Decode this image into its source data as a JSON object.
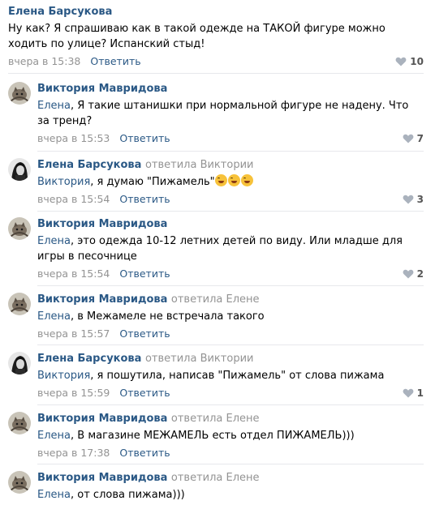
{
  "top": {
    "author": "Елена Барсукова",
    "text": "Ну как? Я спрашиваю как в такой одежде на ТАКОЙ фигуре можно ходить по улице? Испанский стыд!",
    "time": "вчера в 15:38",
    "reply_label": "Ответить",
    "likes": "10"
  },
  "replies": [
    {
      "author": "Виктория Мавридова",
      "replied_to": "",
      "mention": "Елена",
      "text": ", Я такие штанишки при нормальной фигуре не надену. Что за тренд?",
      "time": "вчера в 15:53",
      "reply_label": "Ответить",
      "likes": "7",
      "avatar": "cat-avatar"
    },
    {
      "author": "Елена Барсукова",
      "replied_to": "ответила Виктории",
      "mention": "Виктория",
      "text": ", я думаю \"Пижамель\"",
      "time": "вчера в 15:54",
      "reply_label": "Ответить",
      "likes": "3",
      "avatar": "bw-avatar"
    },
    {
      "author": "Виктория Мавридова",
      "replied_to": "",
      "mention": "Елена",
      "text": ", это одежда 10-12 летних детей по виду. Или младше для игры в песочнице",
      "time": "вчера в 15:54",
      "reply_label": "Ответить",
      "likes": "2",
      "avatar": "cat-avatar"
    },
    {
      "author": "Виктория Мавридова",
      "replied_to": "ответила Елене",
      "mention": "Елена",
      "text": ", в Межамеле не встречала такого",
      "time": "вчера в 15:57",
      "reply_label": "Ответить",
      "likes": "",
      "avatar": "cat-avatar"
    },
    {
      "author": "Елена Барсукова",
      "replied_to": "ответила Виктории",
      "mention": "Виктория",
      "text": ", я пошутила, написав \"Пижамель\" от слова пижама",
      "time": "вчера в 15:59",
      "reply_label": "Ответить",
      "likes": "1",
      "avatar": "bw-avatar"
    },
    {
      "author": "Виктория Мавридова",
      "replied_to": "ответила Елене",
      "mention": "Елена",
      "text": ", В магазине МЕЖАМЕЛЬ есть отдел ПИЖАМЕЛЬ)))",
      "time": "вчера в 17:38",
      "reply_label": "Ответить",
      "likes": "",
      "avatar": "cat-avatar"
    },
    {
      "author": "Виктория Мавридова",
      "replied_to": "ответила Елене",
      "mention": "Елена",
      "text": ", от слова пижама)))",
      "time": "",
      "reply_label": "",
      "likes": "",
      "avatar": "cat-avatar"
    }
  ],
  "colors": {
    "link": "#2a5885",
    "muted": "#939393",
    "separator": "#e7e8ec"
  },
  "icons": {
    "like": "heart-icon",
    "laugh": "rofl-emoji"
  }
}
